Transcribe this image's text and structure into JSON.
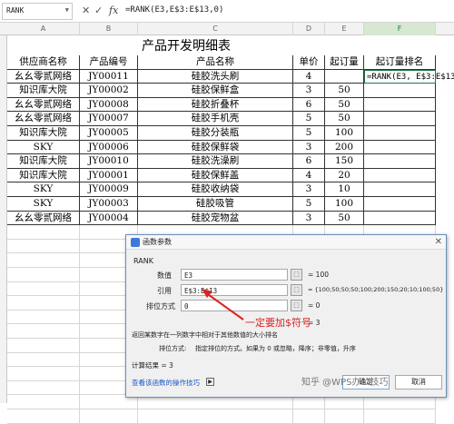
{
  "formula_bar": {
    "name_box": "RANK",
    "cancel_icon": "✕",
    "confirm_icon": "✓",
    "fx": "fx",
    "formula": "=RANK(E3,E$3:E$13,0)"
  },
  "columns": [
    "A",
    "B",
    "C",
    "D",
    "E",
    "F"
  ],
  "sheet": {
    "title": "产品开发明细表",
    "headers": [
      "供应商名称",
      "产品编号",
      "产品名称",
      "单价",
      "起订量",
      "起订量排名"
    ],
    "rows": [
      [
        "幺幺零贰网络",
        "JY00011",
        "硅胶洗头刷",
        "4",
        "",
        "=RANK(E3, E$3:E$13, 0)"
      ],
      [
        "知识库大院",
        "JY00002",
        "硅胶保鲜盒",
        "3",
        "50",
        ""
      ],
      [
        "幺幺零贰网络",
        "JY00008",
        "硅胶折叠杯",
        "6",
        "50",
        ""
      ],
      [
        "幺幺零贰网络",
        "JY00007",
        "硅胶手机壳",
        "5",
        "50",
        ""
      ],
      [
        "知识库大院",
        "JY00005",
        "硅胶分装瓶",
        "5",
        "100",
        ""
      ],
      [
        "SKY",
        "JY00006",
        "硅胶保鲜袋",
        "3",
        "200",
        ""
      ],
      [
        "知识库大院",
        "JY00010",
        "硅胶洗澡刷",
        "6",
        "150",
        ""
      ],
      [
        "知识库大院",
        "JY00001",
        "硅胶保鲜盖",
        "4",
        "20",
        ""
      ],
      [
        "SKY",
        "JY00009",
        "硅胶收纳袋",
        "3",
        "10",
        ""
      ],
      [
        "SKY",
        "JY00003",
        "硅胶吸管",
        "5",
        "100",
        ""
      ],
      [
        "幺幺零贰网络",
        "JY00004",
        "硅胶宠物盆",
        "3",
        "50",
        ""
      ]
    ]
  },
  "dialog": {
    "title": "函数参数",
    "close": "✕",
    "function_name": "RANK",
    "args": [
      {
        "label": "数值",
        "value": "E3",
        "result": "= 100"
      },
      {
        "label": "引用",
        "value": "E$3:E$13",
        "result": "= {100;50;50;50;100;200;150;20;10;100;50}"
      },
      {
        "label": "排位方式",
        "value": "0",
        "result": "= 0"
      }
    ],
    "range_btn": "⬚",
    "overall_result": "= 3",
    "description": "返回某数字在一列数字中相对于其他数值的大小排名",
    "arg_help_label": "排位方式:",
    "arg_help": "指定排位的方式。如果为 0 或忽略，降序；非零值，升序",
    "calc_result": "计算结果 = 3",
    "help_link": "查看该函数的操作技巧",
    "ok": "确定",
    "cancel": "取消"
  },
  "annotation": "一定要加$符号",
  "watermark": "知乎 @WPS办公技巧"
}
